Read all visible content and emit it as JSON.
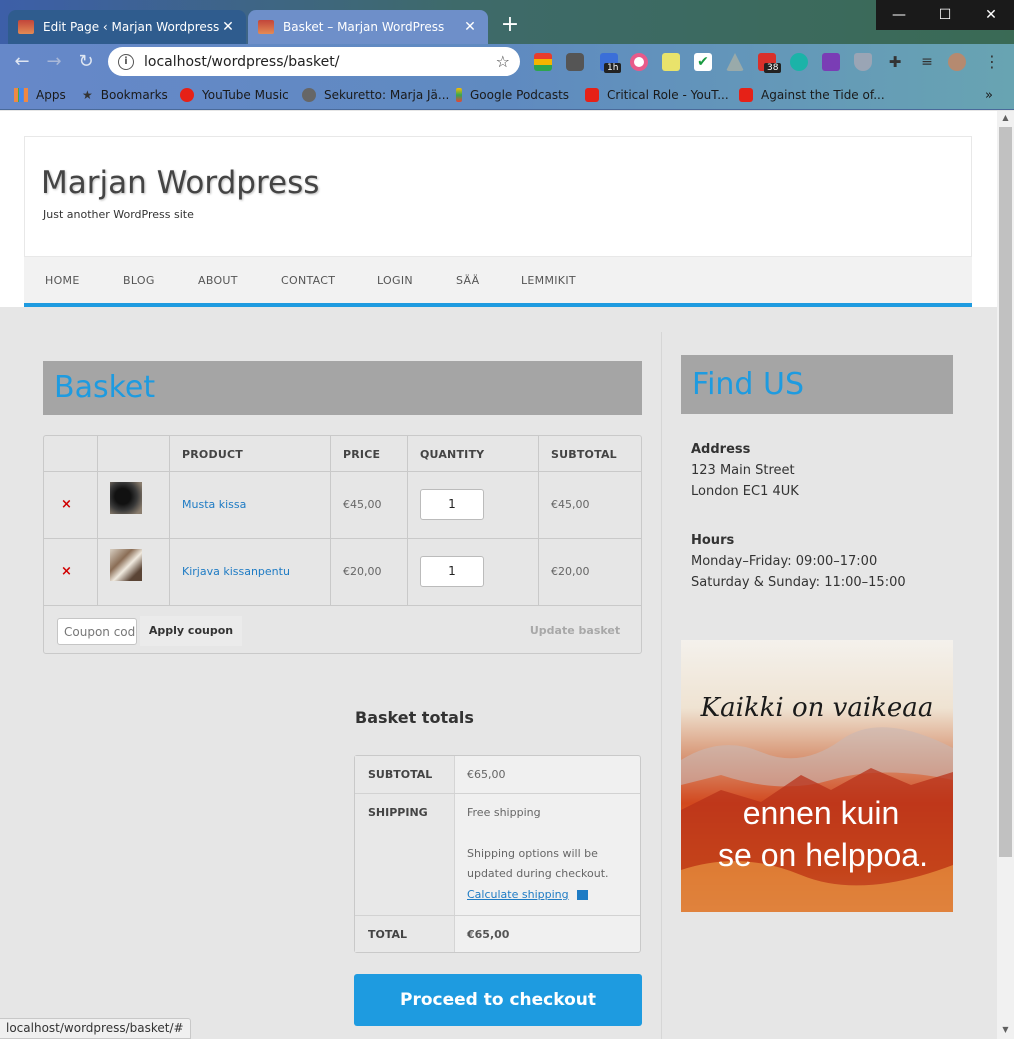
{
  "browser": {
    "tabs": [
      {
        "title": "Edit Page ‹ Marjan Wordpress —"
      },
      {
        "title": "Basket – Marjan WordPress"
      }
    ],
    "url": "localhost/wordpress/basket/",
    "extension_badges": {
      "calendar": "1h",
      "todo": "38"
    },
    "bookmarks": [
      {
        "label": "Apps"
      },
      {
        "label": "Bookmarks"
      },
      {
        "label": "YouTube Music"
      },
      {
        "label": "Sekuretto: Marja Jä..."
      },
      {
        "label": "Google Podcasts"
      },
      {
        "label": "Critical Role - YouT..."
      },
      {
        "label": "Against the Tide of..."
      }
    ],
    "status_url": "localhost/wordpress/basket/#"
  },
  "site": {
    "title": "Marjan Wordpress",
    "description": "Just another WordPress site",
    "nav": [
      "HOME",
      "BLOG",
      "ABOUT",
      "CONTACT",
      "LOGIN",
      "SÄÄ",
      "LEMMIKIT"
    ]
  },
  "basket": {
    "heading": "Basket",
    "columns": [
      "PRODUCT",
      "PRICE",
      "QUANTITY",
      "SUBTOTAL"
    ],
    "items": [
      {
        "name": "Musta kissa",
        "price": "€45,00",
        "quantity": "1",
        "subtotal": "€45,00"
      },
      {
        "name": "Kirjava kissanpentu",
        "price": "€20,00",
        "quantity": "1",
        "subtotal": "€20,00"
      }
    ],
    "remove_glyph": "×",
    "coupon_placeholder": "Coupon code",
    "apply_coupon": "Apply coupon",
    "update_basket": "Update basket"
  },
  "totals": {
    "title": "Basket totals",
    "subtotal_label": "SUBTOTAL",
    "subtotal_value": "€65,00",
    "shipping_label": "SHIPPING",
    "shipping_value": "Free shipping",
    "shipping_note": "Shipping options will be updated during checkout.",
    "calculate_shipping": "Calculate shipping",
    "total_label": "TOTAL",
    "total_value": "€65,00",
    "checkout": "Proceed to checkout"
  },
  "sidebar": {
    "heading": "Find US",
    "address_label": "Address",
    "address_line1": "123 Main Street",
    "address_line2": "London EC1 4UK",
    "hours_label": "Hours",
    "hours_line1": "Monday–Friday: 09:00–17:00",
    "hours_line2": "Saturday & Sunday: 11:00–15:00",
    "image_text_top": "Kaikki on vaikeaa",
    "image_text_bottom1": "ennen kuin",
    "image_text_bottom2": "se on helppoa."
  },
  "colors": {
    "accent": "#1e9be0",
    "heading_bg": "#a5a5a5",
    "remove": "#d00000"
  }
}
